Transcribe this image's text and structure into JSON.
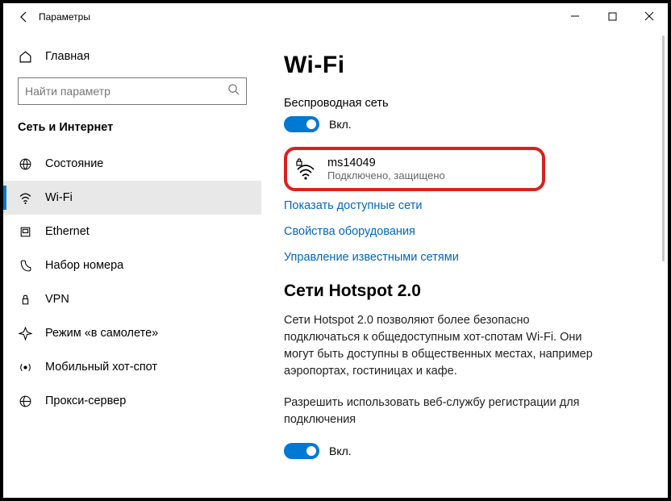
{
  "titlebar": {
    "title": "Параметры"
  },
  "sidebar": {
    "home": "Главная",
    "search_placeholder": "Найти параметр",
    "section": "Сеть и Интернет",
    "items": [
      {
        "label": "Состояние"
      },
      {
        "label": "Wi-Fi"
      },
      {
        "label": "Ethernet"
      },
      {
        "label": "Набор номера"
      },
      {
        "label": "VPN"
      },
      {
        "label": "Режим «в самолете»"
      },
      {
        "label": "Мобильный хот-спот"
      },
      {
        "label": "Прокси-сервер"
      }
    ]
  },
  "main": {
    "heading": "Wi-Fi",
    "wireless_label": "Беспроводная сеть",
    "toggle1": "Вкл.",
    "network": {
      "name": "ms14049",
      "status": "Подключено, защищено"
    },
    "link_show": "Показать доступные сети",
    "link_hw": "Свойства оборудования",
    "link_known": "Управление известными сетями",
    "hotspot_heading": "Сети Hotspot 2.0",
    "hotspot_body": "Сети Hotspot 2.0 позволяют более безопасно подключаться к общедоступным хот-спотам Wi-Fi. Они могут быть доступны в общественных местах, например аэропортах, гостиницах и кафе.",
    "hotspot_allow": "Разрешить использовать веб-службу регистрации для подключения",
    "toggle2": "Вкл."
  }
}
